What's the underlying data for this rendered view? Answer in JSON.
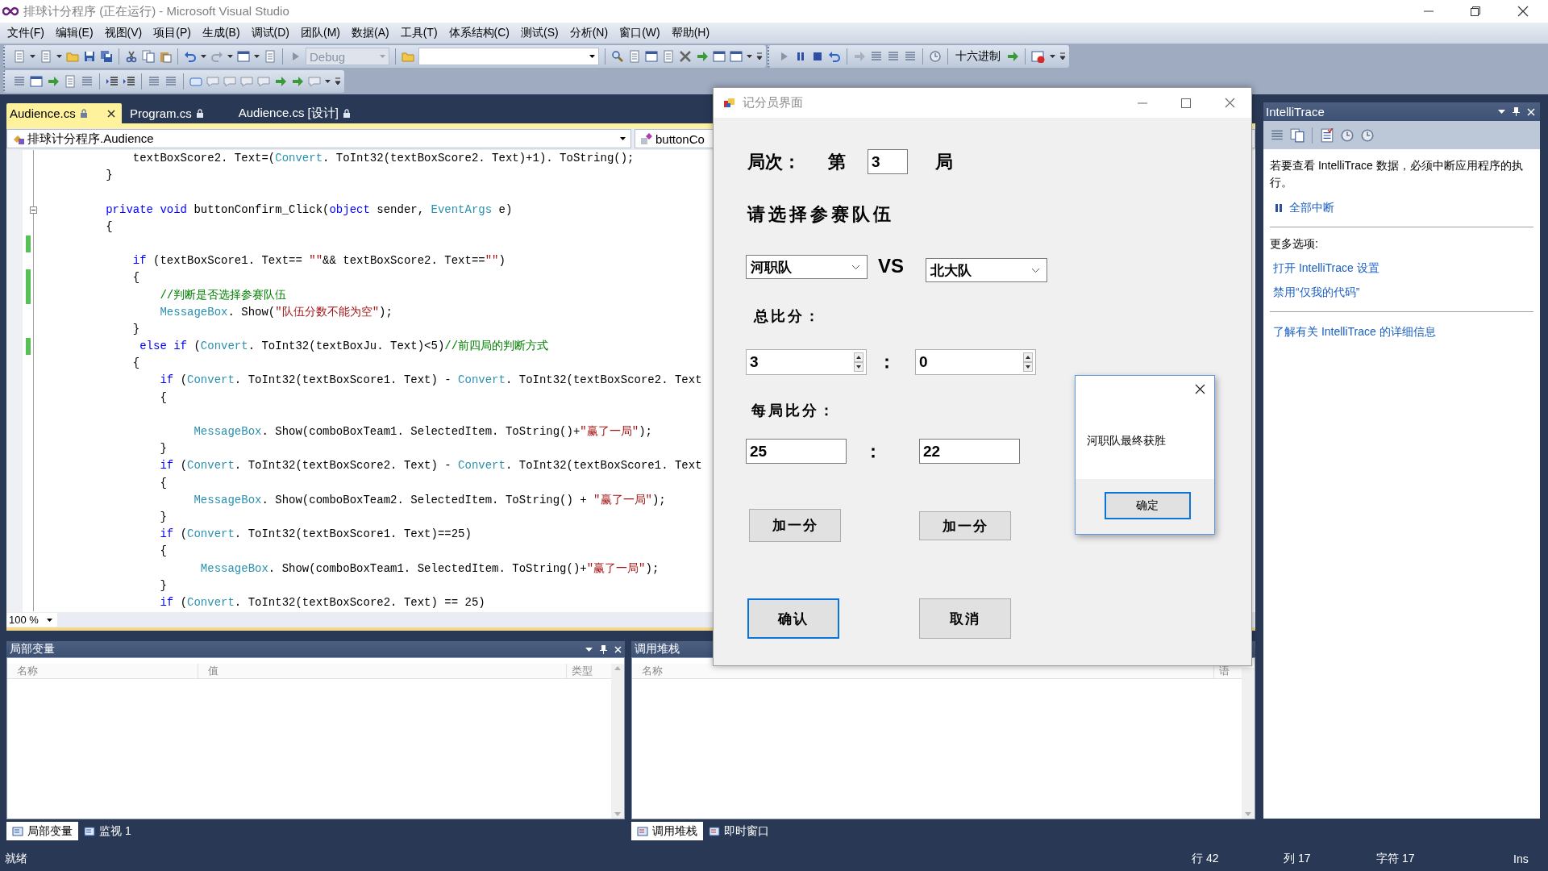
{
  "window": {
    "title": "排球计分程序 (正在运行) - Microsoft Visual Studio"
  },
  "menu": [
    {
      "label": "文件(F)"
    },
    {
      "label": "编辑(E)"
    },
    {
      "label": "视图(V)"
    },
    {
      "label": "项目(P)"
    },
    {
      "label": "生成(B)"
    },
    {
      "label": "调试(D)"
    },
    {
      "label": "团队(M)"
    },
    {
      "label": "数据(A)"
    },
    {
      "label": "工具(T)"
    },
    {
      "label": "体系结构(C)"
    },
    {
      "label": "测试(S)"
    },
    {
      "label": "分析(N)"
    },
    {
      "label": "窗口(W)"
    },
    {
      "label": "帮助(H)"
    }
  ],
  "toolbar": {
    "configuration": "Debug",
    "hex_button": "十六进制"
  },
  "document_tabs": [
    {
      "label": "Audience.cs",
      "selected": true
    },
    {
      "label": "Program.cs",
      "selected": false
    },
    {
      "label": "Audience.cs [设计]",
      "selected": false
    }
  ],
  "navigation": {
    "class_combo": "排球计分程序.Audience",
    "member_combo": "buttonCo"
  },
  "code_lines": [
    {
      "kind": "code",
      "changed": false,
      "fold": false,
      "tokens": [
        {
          "kind": "plain",
          "text": "            textBoxScore2. Text=("
        },
        {
          "kind": "type",
          "text": "Convert"
        },
        {
          "kind": "plain",
          "text": ". ToInt32(textBoxScore2. Text)+1). ToString();"
        }
      ]
    },
    {
      "kind": "code",
      "changed": false,
      "fold": false,
      "tokens": [
        {
          "kind": "plain",
          "text": "        }"
        }
      ]
    },
    {
      "kind": "blank",
      "changed": false,
      "fold": false
    },
    {
      "kind": "code",
      "changed": false,
      "fold": true,
      "tokens": [
        {
          "kind": "keyword",
          "text": "        private"
        },
        {
          "kind": "keyword",
          "text": " void"
        },
        {
          "kind": "plain",
          "text": " buttonConfirm_Click("
        },
        {
          "kind": "keyword",
          "text": "object"
        },
        {
          "kind": "plain",
          "text": " sender, "
        },
        {
          "kind": "type",
          "text": "EventArgs"
        },
        {
          "kind": "plain",
          "text": " e)"
        }
      ]
    },
    {
      "kind": "code",
      "changed": false,
      "fold": false,
      "tokens": [
        {
          "kind": "plain",
          "text": "        {"
        }
      ]
    },
    {
      "kind": "blank",
      "changed": true,
      "fold": false
    },
    {
      "kind": "code",
      "changed": false,
      "fold": false,
      "tokens": [
        {
          "kind": "keyword",
          "text": "            if"
        },
        {
          "kind": "plain",
          "text": " (textBoxScore1. Text== "
        },
        {
          "kind": "string",
          "text": "\"\""
        },
        {
          "kind": "plain",
          "text": "&& textBoxScore2. Text=="
        },
        {
          "kind": "string",
          "text": "\"\""
        },
        {
          "kind": "plain",
          "text": ")"
        }
      ]
    },
    {
      "kind": "code",
      "changed": true,
      "fold": false,
      "tokens": [
        {
          "kind": "plain",
          "text": "            {"
        }
      ]
    },
    {
      "kind": "code",
      "changed": true,
      "fold": false,
      "tokens": [
        {
          "kind": "comment",
          "text": "                //判断是否选择参赛队伍"
        }
      ]
    },
    {
      "kind": "code",
      "changed": false,
      "fold": false,
      "tokens": [
        {
          "kind": "type",
          "text": "                MessageBox"
        },
        {
          "kind": "plain",
          "text": ". Show("
        },
        {
          "kind": "string",
          "text": "\"队伍分数不能为空\""
        },
        {
          "kind": "plain",
          "text": ");"
        }
      ]
    },
    {
      "kind": "code",
      "changed": false,
      "fold": false,
      "tokens": [
        {
          "kind": "plain",
          "text": "            }"
        }
      ]
    },
    {
      "kind": "code",
      "changed": true,
      "fold": false,
      "tokens": [
        {
          "kind": "keyword",
          "text": "             else if"
        },
        {
          "kind": "plain",
          "text": " ("
        },
        {
          "kind": "type",
          "text": "Convert"
        },
        {
          "kind": "plain",
          "text": ". ToInt32(textBoxJu. Text)<5)"
        },
        {
          "kind": "comment",
          "text": "//前四局的判断方式"
        }
      ]
    },
    {
      "kind": "code",
      "changed": false,
      "fold": false,
      "tokens": [
        {
          "kind": "plain",
          "text": "            {"
        }
      ]
    },
    {
      "kind": "code",
      "changed": false,
      "fold": false,
      "tokens": [
        {
          "kind": "keyword",
          "text": "                if"
        },
        {
          "kind": "plain",
          "text": " ("
        },
        {
          "kind": "type",
          "text": "Convert"
        },
        {
          "kind": "plain",
          "text": ". ToInt32(textBoxScore1. Text) - "
        },
        {
          "kind": "type",
          "text": "Convert"
        },
        {
          "kind": "plain",
          "text": ". ToInt32(textBoxScore2. Text"
        }
      ]
    },
    {
      "kind": "code",
      "changed": false,
      "fold": false,
      "tokens": [
        {
          "kind": "plain",
          "text": "                {"
        }
      ]
    },
    {
      "kind": "blank",
      "changed": false,
      "fold": false
    },
    {
      "kind": "code",
      "changed": false,
      "fold": false,
      "tokens": [
        {
          "kind": "type",
          "text": "                     MessageBox"
        },
        {
          "kind": "plain",
          "text": ". Show(comboBoxTeam1. SelectedItem. ToString()+"
        },
        {
          "kind": "string",
          "text": "\"赢了一局\""
        },
        {
          "kind": "plain",
          "text": ");"
        }
      ]
    },
    {
      "kind": "code",
      "changed": false,
      "fold": false,
      "tokens": [
        {
          "kind": "plain",
          "text": "                }"
        }
      ]
    },
    {
      "kind": "code",
      "changed": false,
      "fold": false,
      "tokens": [
        {
          "kind": "keyword",
          "text": "                if"
        },
        {
          "kind": "plain",
          "text": " ("
        },
        {
          "kind": "type",
          "text": "Convert"
        },
        {
          "kind": "plain",
          "text": ". ToInt32(textBoxScore2. Text) - "
        },
        {
          "kind": "type",
          "text": "Convert"
        },
        {
          "kind": "plain",
          "text": ". ToInt32(textBoxScore1. Text"
        }
      ]
    },
    {
      "kind": "code",
      "changed": false,
      "fold": false,
      "tokens": [
        {
          "kind": "plain",
          "text": "                {"
        }
      ]
    },
    {
      "kind": "code",
      "changed": false,
      "fold": false,
      "tokens": [
        {
          "kind": "type",
          "text": "                     MessageBox"
        },
        {
          "kind": "plain",
          "text": ". Show(comboBoxTeam2. SelectedItem. ToString() + "
        },
        {
          "kind": "string",
          "text": "\"赢了一局\""
        },
        {
          "kind": "plain",
          "text": ");"
        }
      ]
    },
    {
      "kind": "code",
      "changed": false,
      "fold": false,
      "tokens": [
        {
          "kind": "plain",
          "text": "                }"
        }
      ]
    },
    {
      "kind": "code",
      "changed": false,
      "fold": false,
      "tokens": [
        {
          "kind": "keyword",
          "text": "                if"
        },
        {
          "kind": "plain",
          "text": " ("
        },
        {
          "kind": "type",
          "text": "Convert"
        },
        {
          "kind": "plain",
          "text": ". ToInt32(textBoxScore1. Text)==25)"
        }
      ]
    },
    {
      "kind": "code",
      "changed": false,
      "fold": false,
      "tokens": [
        {
          "kind": "plain",
          "text": "                {"
        }
      ]
    },
    {
      "kind": "code",
      "changed": false,
      "fold": false,
      "tokens": [
        {
          "kind": "type",
          "text": "                      MessageBox"
        },
        {
          "kind": "plain",
          "text": ". Show(comboBoxTeam1. SelectedItem. ToString()+"
        },
        {
          "kind": "string",
          "text": "\"赢了一局\""
        },
        {
          "kind": "plain",
          "text": ");"
        }
      ]
    },
    {
      "kind": "code",
      "changed": false,
      "fold": false,
      "tokens": [
        {
          "kind": "plain",
          "text": "                }"
        }
      ]
    },
    {
      "kind": "code",
      "changed": false,
      "fold": false,
      "tokens": [
        {
          "kind": "keyword",
          "text": "                if"
        },
        {
          "kind": "plain",
          "text": " ("
        },
        {
          "kind": "type",
          "text": "Convert"
        },
        {
          "kind": "plain",
          "text": ". ToInt32(textBoxScore2. Text) == 25)"
        }
      ]
    }
  ],
  "zoom": "100 %",
  "locals_panel": {
    "title": "局部变量",
    "columns": [
      "名称",
      "值",
      "类型"
    ],
    "tabs": [
      {
        "label": "局部变量",
        "selected": true
      },
      {
        "label": "监视 1",
        "selected": false
      }
    ]
  },
  "call_stack_panel": {
    "title": "调用堆栈",
    "columns": [
      "名称",
      "语"
    ],
    "tabs": [
      {
        "label": "调用堆栈",
        "selected": true
      },
      {
        "label": "即时窗口",
        "selected": false
      }
    ]
  },
  "intellitrace": {
    "title": "IntelliTrace",
    "message": "若要查看 IntelliTrace 数据，必须中断应用程序的执行。",
    "break_all": "全部中断",
    "more_label": "更多选项:",
    "links": [
      "打开 IntelliTrace 设置",
      "禁用“仅我的代码”"
    ],
    "learn_more": "了解有关 IntelliTrace 的详细信息"
  },
  "dialog": {
    "title": "记分员界面",
    "round_label": "局次：",
    "round_prefix": "第",
    "round_value": "3",
    "round_suffix": "局",
    "teams_prompt": "请选择参赛队伍",
    "team1": "河职队",
    "vs": "VS",
    "team2": "北大队",
    "total_label": "总比分：",
    "total1": "3",
    "total_colon": "：",
    "total2": "0",
    "game_label": "每局比分：",
    "game1": "25",
    "game_colon": "：",
    "game2": "22",
    "add_buttons": [
      {
        "label": "加一分"
      },
      {
        "label": "加一分"
      }
    ],
    "actions": [
      {
        "label": "确认",
        "focused": true
      },
      {
        "label": "取消",
        "focused": false
      }
    ]
  },
  "message_box": {
    "text": "河职队最终获胜",
    "button": {
      "label": "确定",
      "focused": true
    }
  },
  "status_bar": {
    "state": "就绪",
    "line": "行 42",
    "column": "列 17",
    "char": "字符 17",
    "mode": "Ins"
  }
}
